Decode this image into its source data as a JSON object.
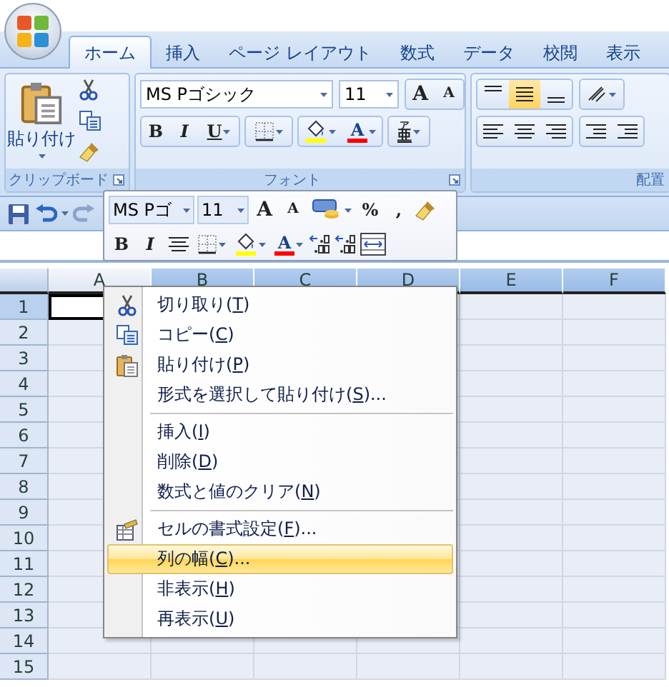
{
  "tabs": [
    {
      "label": "ホーム",
      "selected": true
    },
    {
      "label": "挿入",
      "selected": false
    },
    {
      "label": "ページ レイアウト",
      "selected": false
    },
    {
      "label": "数式",
      "selected": false
    },
    {
      "label": "データ",
      "selected": false
    },
    {
      "label": "校閲",
      "selected": false
    },
    {
      "label": "表示",
      "selected": false
    }
  ],
  "clipboard": {
    "paste_label": "貼り付け",
    "label": "クリップボード"
  },
  "font_group": {
    "font_name": "MS Pゴシック",
    "font_size": "11",
    "grow": "A",
    "shrink": "A",
    "bold": "B",
    "italic": "I",
    "underline": "U",
    "font_color": "A",
    "phonetic_ruby": "ア",
    "phonetic": "亜",
    "label": "フォント"
  },
  "alignment_group": {
    "label": "配置"
  },
  "mini_toolbar": {
    "font_name": "MS Pゴ",
    "font_size": "11",
    "grow": "A",
    "shrink": "A",
    "percent": "%",
    "comma": ",",
    "bold": "B",
    "italic": "I",
    "font_color": "A"
  },
  "sheet": {
    "columns": [
      {
        "label": "A",
        "selected": false
      },
      {
        "label": "B",
        "selected": true
      },
      {
        "label": "C",
        "selected": true
      },
      {
        "label": "D",
        "selected": true
      },
      {
        "label": "E",
        "selected": true
      },
      {
        "label": "F",
        "selected": true
      }
    ],
    "rows": [
      "1",
      "2",
      "3",
      "4",
      "5",
      "6",
      "7",
      "8",
      "9",
      "10",
      "11",
      "12",
      "13",
      "14",
      "15"
    ]
  },
  "context_menu": {
    "items": [
      {
        "kind": "item",
        "before": "切り取り(",
        "key": "T",
        "after": ")",
        "selected": false
      },
      {
        "kind": "item",
        "before": "コピー(",
        "key": "C",
        "after": ")",
        "selected": false
      },
      {
        "kind": "item",
        "before": "貼り付け(",
        "key": "P",
        "after": ")",
        "selected": false
      },
      {
        "kind": "item",
        "before": "形式を選択して貼り付け(",
        "key": "S",
        "after": ")...",
        "selected": false
      },
      {
        "kind": "separator"
      },
      {
        "kind": "item",
        "before": "挿入(",
        "key": "I",
        "after": ")",
        "selected": false
      },
      {
        "kind": "item",
        "before": "削除(",
        "key": "D",
        "after": ")",
        "selected": false
      },
      {
        "kind": "item",
        "before": "数式と値のクリア(",
        "key": "N",
        "after": ")",
        "selected": false
      },
      {
        "kind": "separator"
      },
      {
        "kind": "item",
        "before": "セルの書式設定(",
        "key": "F",
        "after": ")...",
        "selected": false
      },
      {
        "kind": "item",
        "before": "列の幅(",
        "key": "C",
        "after": ")...",
        "selected": true
      },
      {
        "kind": "item",
        "before": "非表示(",
        "key": "H",
        "after": ")",
        "selected": false
      },
      {
        "kind": "item",
        "before": "再表示(",
        "key": "U",
        "after": ")",
        "selected": false
      }
    ]
  }
}
